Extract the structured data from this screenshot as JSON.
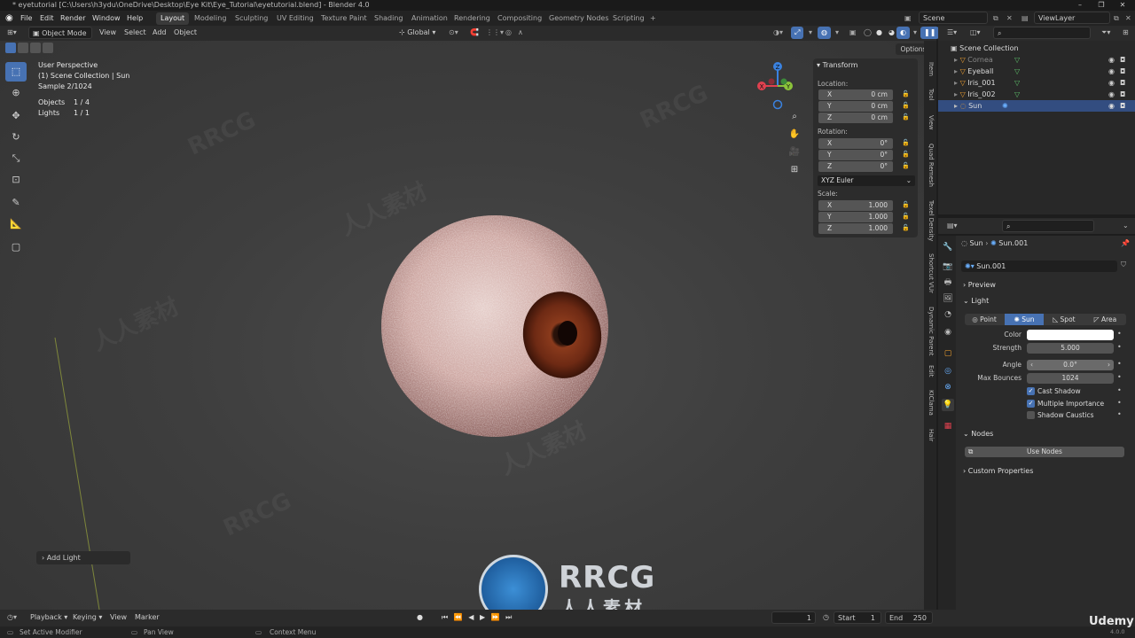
{
  "window": {
    "title": "* eyetutorial [C:\\Users\\h3ydu\\OneDrive\\Desktop\\Eye Kit\\Eye_Tutorial\\eyetutorial.blend] - Blender 4.0"
  },
  "menu": {
    "items": [
      "File",
      "Edit",
      "Render",
      "Window",
      "Help"
    ]
  },
  "workspaces": [
    "Layout",
    "Modeling",
    "Sculpting",
    "UV Editing",
    "Texture Paint",
    "Shading",
    "Animation",
    "Rendering",
    "Compositing",
    "Geometry Nodes",
    "Scripting"
  ],
  "active_workspace": "Layout",
  "scene": {
    "name": "Scene",
    "view_layer": "ViewLayer"
  },
  "viewport_header": {
    "mode": "Object Mode",
    "menus": [
      "View",
      "Select",
      "Add",
      "Object"
    ],
    "orientation": "Global",
    "options": "Options"
  },
  "viewport_overlay": {
    "perspective": "User Perspective",
    "collection": "(1) Scene Collection | Sun",
    "sample": "Sample 2/1024",
    "objects_label": "Objects",
    "objects_value": "1 / 4",
    "lights_label": "Lights",
    "lights_value": "1 / 1"
  },
  "gizmo": {
    "x": "X",
    "y": "Y",
    "z": "Z"
  },
  "transform_panel": {
    "title": "Transform",
    "location_label": "Location:",
    "location": [
      {
        "axis": "X",
        "value": "0 cm"
      },
      {
        "axis": "Y",
        "value": "0 cm"
      },
      {
        "axis": "Z",
        "value": "0 cm"
      }
    ],
    "rotation_label": "Rotation:",
    "rotation": [
      {
        "axis": "X",
        "value": "0°"
      },
      {
        "axis": "Y",
        "value": "0°"
      },
      {
        "axis": "Z",
        "value": "0°"
      }
    ],
    "rotation_mode": "XYZ Euler",
    "scale_label": "Scale:",
    "scale": [
      {
        "axis": "X",
        "value": "1.000"
      },
      {
        "axis": "Y",
        "value": "1.000"
      },
      {
        "axis": "Z",
        "value": "1.000"
      }
    ]
  },
  "side_tabs": [
    "Item",
    "Tool",
    "View",
    "Quad Remesh",
    "Texel Density",
    "Shortcut VUr",
    "Dynamic Parent",
    "Edit",
    "KIClama",
    "Hair"
  ],
  "outliner": {
    "root": "Scene Collection",
    "items": [
      {
        "name": "Cornea",
        "dimmed": true
      },
      {
        "name": "Eyeball",
        "dimmed": false
      },
      {
        "name": "Iris_001",
        "dimmed": false
      },
      {
        "name": "Iris_002",
        "dimmed": false
      },
      {
        "name": "Sun",
        "dimmed": false,
        "selected": true
      }
    ]
  },
  "properties": {
    "breadcrumb_object": "Sun",
    "breadcrumb_data": "Sun.001",
    "datablock": "Sun.001",
    "preview_label": "Preview",
    "light_label": "Light",
    "light_types": [
      "Point",
      "Sun",
      "Spot",
      "Area"
    ],
    "active_light_type": "Sun",
    "color_label": "Color",
    "color_value": "#ffffff",
    "strength_label": "Strength",
    "strength_value": "5.000",
    "angle_label": "Angle",
    "angle_value": "0.0°",
    "max_bounces_label": "Max Bounces",
    "max_bounces_value": "1024",
    "cast_shadow_label": "Cast Shadow",
    "cast_shadow": true,
    "multiple_importance_label": "Multiple Importance",
    "multiple_importance": true,
    "shadow_caustics_label": "Shadow Caustics",
    "shadow_caustics": false,
    "nodes_label": "Nodes",
    "use_nodes_label": "Use Nodes",
    "custom_properties_label": "Custom Properties"
  },
  "operator_panel": {
    "label": "Add Light"
  },
  "timeline": {
    "menus": [
      "Playback",
      "Keying",
      "View",
      "Marker"
    ],
    "current_frame": "1",
    "start_label": "Start",
    "start_value": "1",
    "end_label": "End",
    "end_value": "250"
  },
  "statusbar": {
    "items": [
      "Set Active Modifier",
      "Pan View",
      "Context Menu"
    ],
    "version": "4.0.0"
  },
  "watermark": {
    "brand": "RRCG",
    "sub": "人人素材",
    "udemy": "Udemy"
  },
  "colors": {
    "accent": "#4772b3",
    "selection": "#334d80",
    "gizmo_x": "#e0414f",
    "gizmo_y": "#8bc33a",
    "gizmo_z": "#3a82e0",
    "light_icon": "#f0a030",
    "object_icon": "#5ec26a"
  }
}
